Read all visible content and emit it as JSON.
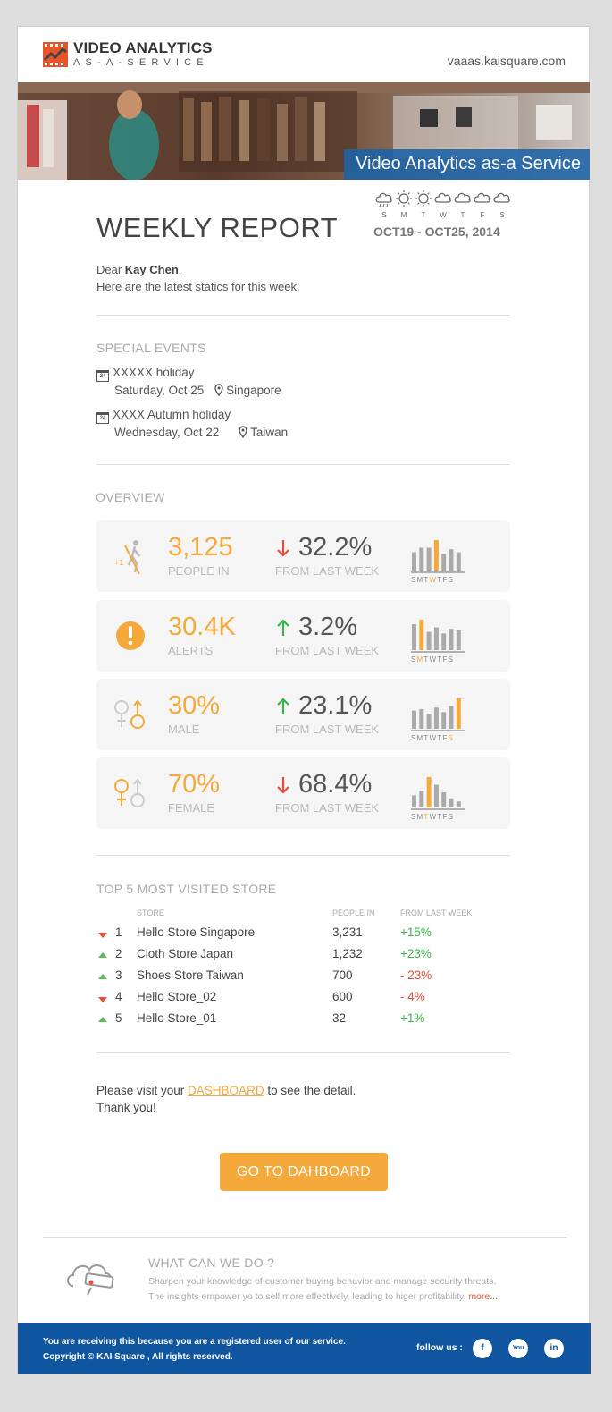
{
  "header": {
    "logo_title": "VIDEO ANALYTICS",
    "logo_subtitle": "AS-A-SERVICE",
    "site": "vaaas.kaisquare.com",
    "hero_text": "Video Analytics as-a Service"
  },
  "weather": {
    "days": [
      "S",
      "M",
      "T",
      "W",
      "T",
      "F",
      "S"
    ],
    "icons": [
      "rain-cloud-icon",
      "sun-icon",
      "sun-icon",
      "cloud-icon",
      "cloud-icon",
      "cloud-icon",
      "cloud-icon"
    ]
  },
  "report": {
    "title": "WEEKLY REPORT",
    "date_range": "OCT19 - OCT25, 2014",
    "greeting_prefix": "Dear ",
    "recipient": "Kay Chen",
    "greeting_suffix": ",",
    "intro": "Here are the latest statics for this week."
  },
  "events": {
    "heading": "SPECIAL EVENTS",
    "items": [
      {
        "date_num": "24",
        "name": "XXXXX holiday",
        "date": "Saturday, Oct 25",
        "location": "Singapore"
      },
      {
        "date_num": "24",
        "name": "XXXX Autumn holiday",
        "date": "Wednesday, Oct 22",
        "location": "Taiwan"
      }
    ]
  },
  "overview": {
    "heading": "OVERVIEW",
    "day_letters": [
      "S",
      "M",
      "T",
      "W",
      "T",
      "F",
      "S"
    ],
    "stats": [
      {
        "value": "3,125",
        "label": "PEOPLE IN",
        "change": "32.2%",
        "direction": "down",
        "change_label": "FROM LAST WEEK",
        "icon": "walking-person-icon",
        "highlight_day": 3,
        "bars": [
          0.6,
          0.75,
          0.75,
          1.0,
          0.55,
          0.7,
          0.6
        ]
      },
      {
        "value": "30.4K",
        "label": "ALERTS",
        "change": "3.2%",
        "direction": "up",
        "change_label": "FROM LAST WEEK",
        "icon": "alert-icon",
        "highlight_day": 1,
        "bars": [
          0.85,
          1.0,
          0.6,
          0.75,
          0.55,
          0.7,
          0.65
        ]
      },
      {
        "value": "30%",
        "label": "MALE",
        "change": "23.1%",
        "direction": "up",
        "change_label": "FROM LAST WEEK",
        "icon": "male-symbol-icon",
        "highlight_day": 6,
        "bars": [
          0.6,
          0.65,
          0.5,
          0.7,
          0.55,
          0.75,
          1.0
        ]
      },
      {
        "value": "70%",
        "label": "FEMALE",
        "change": "68.4%",
        "direction": "down",
        "change_label": "FROM LAST WEEK",
        "icon": "female-symbol-icon",
        "highlight_day": 2,
        "bars": [
          0.4,
          0.55,
          1.0,
          0.75,
          0.5,
          0.3,
          0.2
        ]
      }
    ]
  },
  "top_stores": {
    "heading": "TOP 5  MOST VISITED STORE",
    "columns": [
      "STORE",
      "PEOPLE IN",
      "FROM LAST WEEK"
    ],
    "rows": [
      {
        "trend": "down",
        "rank": "1",
        "store": "Hello Store Singapore",
        "people": "3,231",
        "change": "+15%",
        "sign": "pos"
      },
      {
        "trend": "up",
        "rank": "2",
        "store": "Cloth Store Japan",
        "people": "1,232",
        "change": "+23%",
        "sign": "pos"
      },
      {
        "trend": "up",
        "rank": "3",
        "store": "Shoes Store  Taiwan",
        "people": "700",
        "change": "- 23%",
        "sign": "neg"
      },
      {
        "trend": "down",
        "rank": "4",
        "store": "Hello Store_02",
        "people": "600",
        "change": "- 4%",
        "sign": "neg"
      },
      {
        "trend": "up",
        "rank": "5",
        "store": "Hello Store_01",
        "people": "32",
        "change": "+1%",
        "sign": "pos"
      }
    ]
  },
  "closing": {
    "prefix": "Please visit your ",
    "link": "DASHBOARD",
    "suffix": " to see the detail.",
    "thanks": "Thank you!",
    "button": "GO TO DAHBOARD"
  },
  "what": {
    "heading": "WHAT CAN WE DO ?",
    "line1": "Sharpen your knowledge of customer buying behavior and manage security threats.",
    "line2": "The insights empower yo to sell more effectively, leading to higer profitability. ",
    "more": "more..."
  },
  "footer": {
    "line1": "You are receiving this because you are a registered user of our service.",
    "line2": "Copyright © KAI Square , All rights reserved.",
    "follow": "follow us :",
    "social": [
      {
        "icon": "facebook-icon",
        "glyph": "f"
      },
      {
        "icon": "youtube-icon",
        "glyph": "You"
      },
      {
        "icon": "linkedin-icon",
        "glyph": "in"
      }
    ]
  },
  "colors": {
    "accent": "#f6a93b",
    "footer": "#0f55a0",
    "up": "#3ab54a",
    "down": "#e74c3c"
  }
}
